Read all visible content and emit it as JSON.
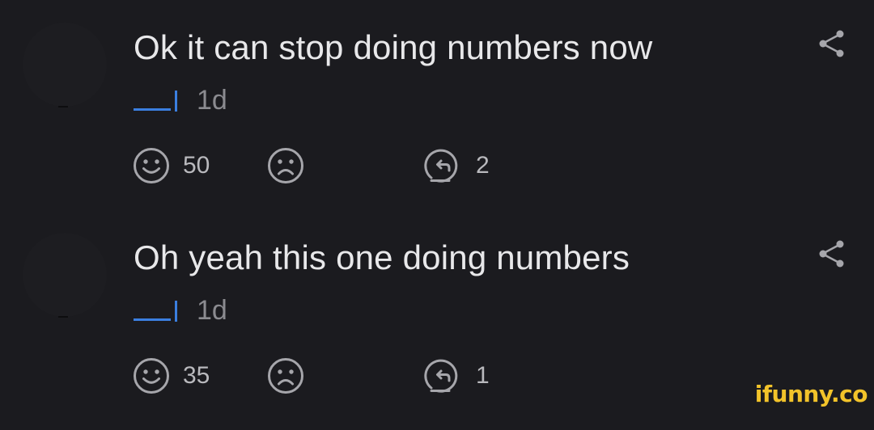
{
  "comments": [
    {
      "text": "Ok it can stop doing numbers now",
      "time": "1d",
      "upvotes": "50",
      "replies": "2"
    },
    {
      "text": "Oh yeah this one doing numbers",
      "time": "1d",
      "upvotes": "35",
      "replies": "1"
    }
  ],
  "icons": {
    "share": "share-icon",
    "smile": "smile-icon",
    "frown": "frown-icon",
    "reply": "reply-icon"
  },
  "colors": {
    "background": "#1b1b1f",
    "text": "#e8e8ea",
    "muted": "#8b8b90",
    "accent": "#3b7fe0",
    "watermark": "#f2c32a"
  },
  "watermark": "ifunny.co"
}
